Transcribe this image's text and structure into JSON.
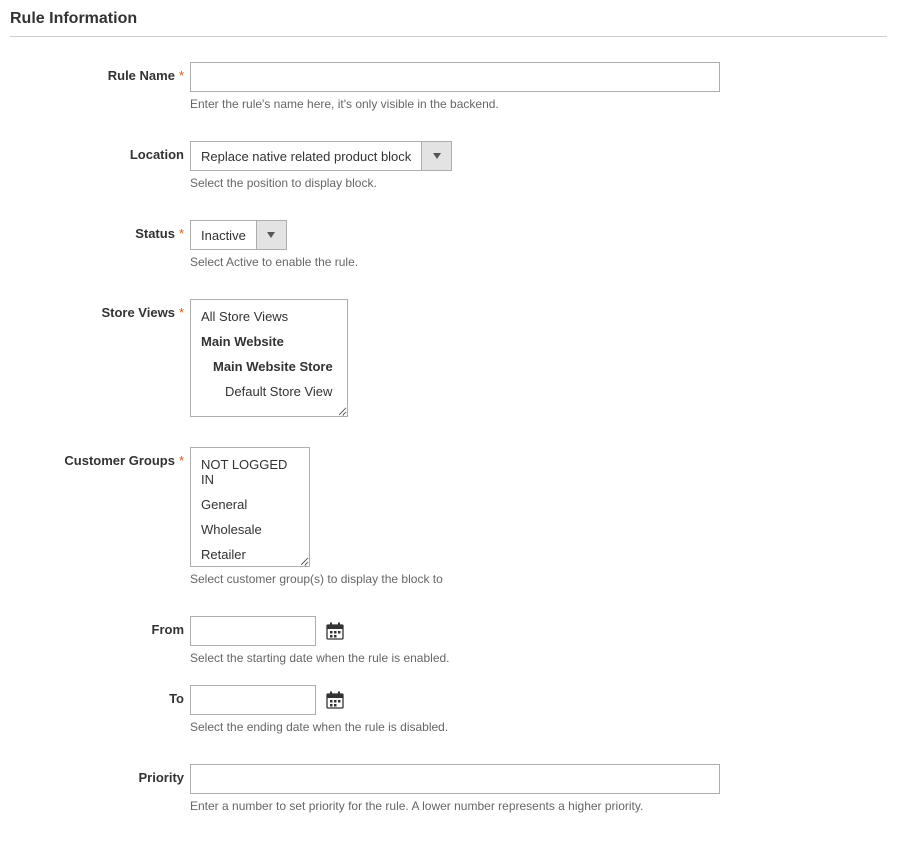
{
  "section_title": "Rule Information",
  "labels": {
    "rule_name": "Rule Name",
    "location": "Location",
    "status": "Status",
    "store_views": "Store Views",
    "customer_groups": "Customer Groups",
    "from": "From",
    "to": "To",
    "priority": "Priority"
  },
  "required_marker": "*",
  "fields": {
    "rule_name": {
      "value": "",
      "hint": "Enter the rule's name here, it's only visible in the backend."
    },
    "location": {
      "selected": "Replace native related product block",
      "hint": "Select the position to display block."
    },
    "status": {
      "selected": "Inactive",
      "hint": "Select Active to enable the rule."
    },
    "store_views": {
      "options": [
        {
          "label": "All Store Views",
          "indent": 0,
          "bold": false
        },
        {
          "label": "Main Website",
          "indent": 0,
          "bold": true
        },
        {
          "label": "Main Website Store",
          "indent": 1,
          "bold": true
        },
        {
          "label": "Default Store View",
          "indent": 2,
          "bold": false
        }
      ]
    },
    "customer_groups": {
      "options": [
        {
          "label": "NOT LOGGED IN"
        },
        {
          "label": "General"
        },
        {
          "label": "Wholesale"
        },
        {
          "label": "Retailer"
        }
      ],
      "hint": "Select customer group(s) to display the block to"
    },
    "from": {
      "value": "",
      "hint": "Select the starting date when the rule is enabled."
    },
    "to": {
      "value": "",
      "hint": "Select the ending date when the rule is disabled."
    },
    "priority": {
      "value": "",
      "hint": "Enter a number to set priority for the rule. A lower number represents a higher priority."
    }
  }
}
